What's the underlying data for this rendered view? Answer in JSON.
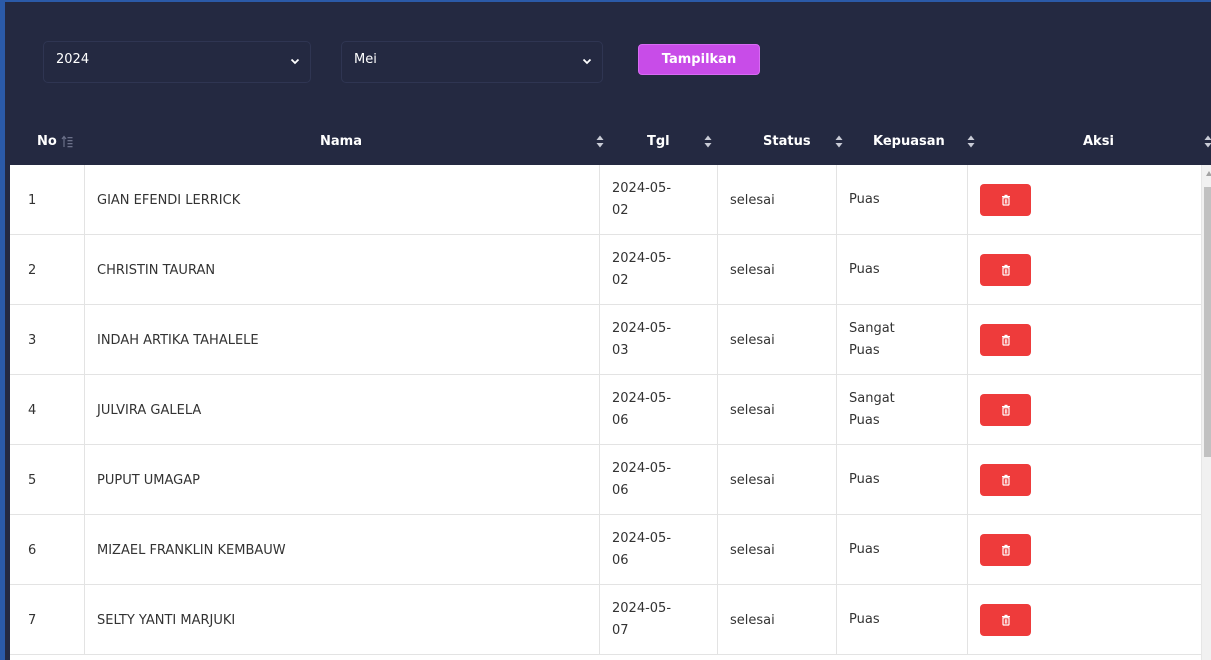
{
  "filters": {
    "year": "2024",
    "month": "Mei",
    "show_label": "Tampilkan"
  },
  "table": {
    "headers": {
      "no": "No",
      "nama": "Nama",
      "tgl": "Tgl",
      "status": "Status",
      "kepuasan": "Kepuasan",
      "aksi": "Aksi"
    },
    "rows": [
      {
        "no": "1",
        "nama": "GIAN EFENDI LERRICK",
        "tgl_a": "2024-05-",
        "tgl_b": "02",
        "status": "selesai",
        "kep_a": "Puas",
        "kep_b": ""
      },
      {
        "no": "2",
        "nama": "CHRISTIN TAURAN",
        "tgl_a": "2024-05-",
        "tgl_b": "02",
        "status": "selesai",
        "kep_a": "Puas",
        "kep_b": ""
      },
      {
        "no": "3",
        "nama": "INDAH ARTIKA TAHALELE",
        "tgl_a": "2024-05-",
        "tgl_b": "03",
        "status": "selesai",
        "kep_a": "Sangat",
        "kep_b": "Puas"
      },
      {
        "no": "4",
        "nama": "JULVIRA GALELA",
        "tgl_a": "2024-05-",
        "tgl_b": "06",
        "status": "selesai",
        "kep_a": "Sangat",
        "kep_b": "Puas"
      },
      {
        "no": "5",
        "nama": "PUPUT UMAGAP",
        "tgl_a": "2024-05-",
        "tgl_b": "06",
        "status": "selesai",
        "kep_a": "Puas",
        "kep_b": ""
      },
      {
        "no": "6",
        "nama": "MIZAEL FRANKLIN KEMBAUW",
        "tgl_a": "2024-05-",
        "tgl_b": "06",
        "status": "selesai",
        "kep_a": "Puas",
        "kep_b": ""
      },
      {
        "no": "7",
        "nama": "SELTY YANTI MARJUKI",
        "tgl_a": "2024-05-",
        "tgl_b": "07",
        "status": "selesai",
        "kep_a": "Puas",
        "kep_b": ""
      }
    ]
  },
  "icons": {
    "select_chevron": "chevron-down-icon",
    "sort": "sort-icon",
    "sort_active": "sort-ascending-icon",
    "delete": "trash-icon"
  },
  "colors": {
    "background": "#242941",
    "accent_button": "#c84ce8",
    "delete_button": "#ee3b3b"
  }
}
